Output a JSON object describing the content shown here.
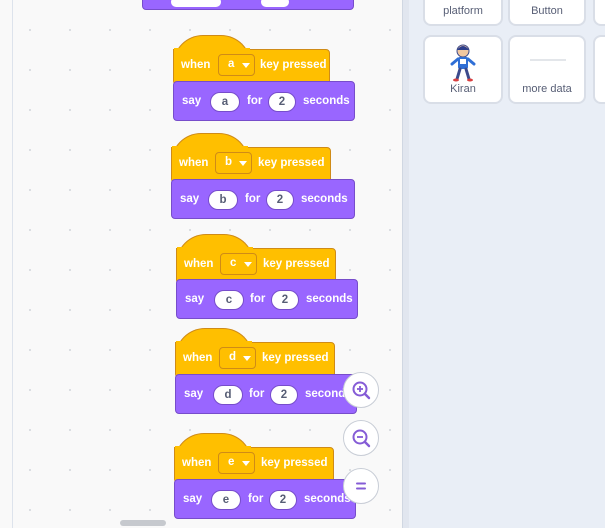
{
  "sprites": [
    {
      "name": "platform"
    },
    {
      "name": "Button"
    },
    {
      "name": "Kiran"
    },
    {
      "name": "more data"
    }
  ],
  "hat_blocks": [
    {
      "when": "when",
      "key": "a",
      "pressed": "key pressed"
    },
    {
      "when": "when",
      "key": "b",
      "pressed": "key pressed"
    },
    {
      "when": "when",
      "key": "c",
      "pressed": "key pressed"
    },
    {
      "when": "when",
      "key": "d",
      "pressed": "key pressed"
    },
    {
      "when": "when",
      "key": "e",
      "pressed": "key pressed"
    }
  ],
  "say_blocks": [
    {
      "say": "say",
      "message": "a",
      "for": "for",
      "secs": "2",
      "seconds": "seconds"
    },
    {
      "say": "say",
      "message": "b",
      "for": "for",
      "secs": "2",
      "seconds": "seconds"
    },
    {
      "say": "say",
      "message": "c",
      "for": "for",
      "secs": "2",
      "seconds": "seconds"
    },
    {
      "say": "say",
      "message": "d",
      "for": "for",
      "secs": "2",
      "seconds": "seconds"
    },
    {
      "say": "say",
      "message": "e",
      "for": "for",
      "secs": "2",
      "seconds": "seconds"
    }
  ],
  "colors": {
    "events": "#ffbf00",
    "looks": "#9966ff",
    "workspace": "#f9f9f9",
    "sprite_pane": "#e9eef6"
  },
  "icons": {
    "zoom_in": "zoom-in-icon",
    "zoom_out": "zoom-out-icon",
    "zoom_reset": "zoom-reset-icon"
  }
}
